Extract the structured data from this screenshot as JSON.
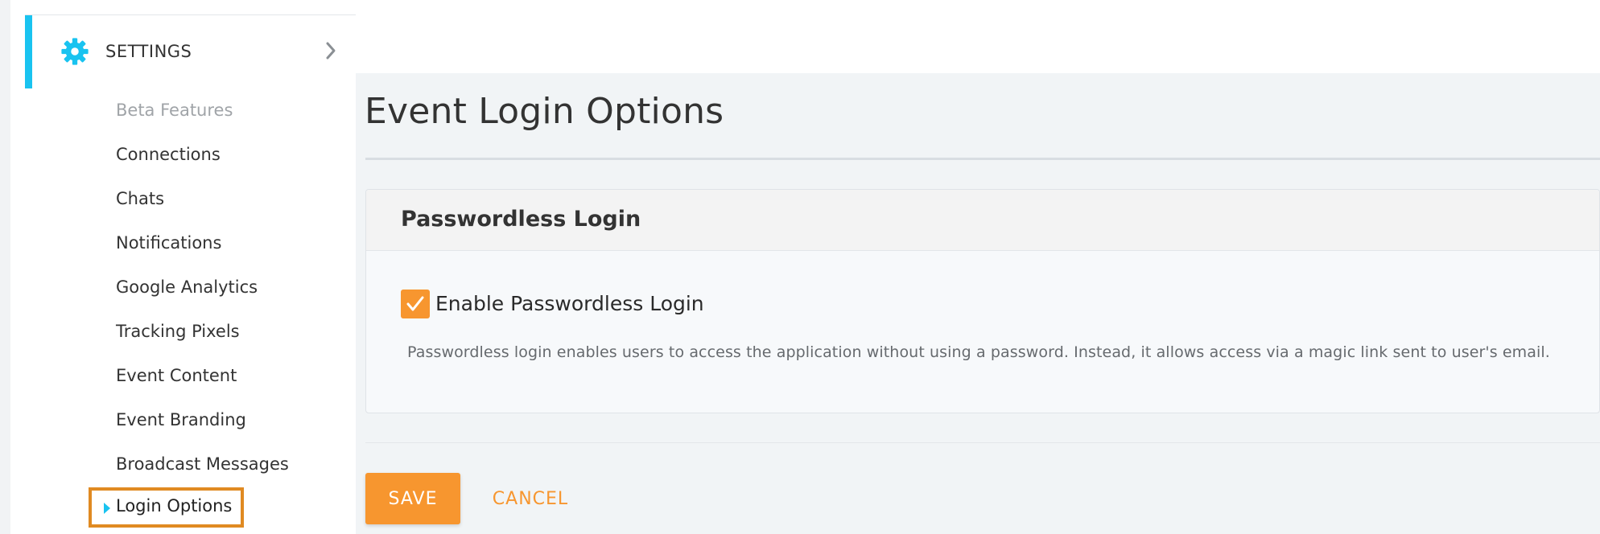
{
  "sidebar": {
    "section": {
      "icon": "gear-icon",
      "label": "SETTINGS",
      "chevron_icon": "chevron-right-icon"
    },
    "items": [
      {
        "label": "Beta Features",
        "state": "disabled"
      },
      {
        "label": "Connections"
      },
      {
        "label": "Chats"
      },
      {
        "label": "Notifications"
      },
      {
        "label": "Google Analytics"
      },
      {
        "label": "Tracking Pixels"
      },
      {
        "label": "Event Content"
      },
      {
        "label": "Event Branding"
      },
      {
        "label": "Broadcast Messages"
      },
      {
        "label": "Login Options",
        "state": "active"
      }
    ]
  },
  "main": {
    "title": "Event Login Options",
    "panel": {
      "title": "Passwordless Login",
      "checkbox": {
        "label": "Enable Passwordless Login",
        "checked": true
      },
      "help_text": "Passwordless login enables users to access the application without using a password. Instead, it allows access via a magic link sent to user's email."
    },
    "actions": {
      "save_label": "SAVE",
      "cancel_label": "CANCEL"
    }
  },
  "colors": {
    "accent_blue": "#19c3f0",
    "accent_orange": "#f7962f",
    "highlight_border": "#e08a22",
    "content_background": "#f1f4f6"
  }
}
